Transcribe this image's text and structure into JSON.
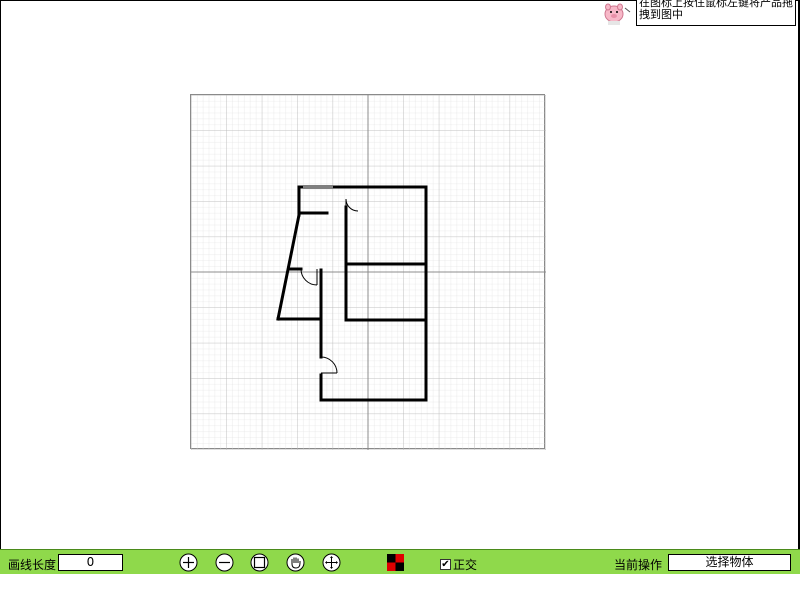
{
  "tip": {
    "text": "在图标上按住鼠标左键将产品拖拽到图中"
  },
  "icons": {
    "pig": "pig-mascot-icon",
    "zoom_in": "zoom-in-icon",
    "zoom_out": "zoom-out-icon",
    "fit": "fit-to-screen-icon",
    "pan": "hand-pan-icon",
    "move": "move-arrows-icon",
    "color": "color-picker-icon"
  },
  "toolbar": {
    "line_length_label": "画线长度",
    "line_length_value": "0",
    "ortho_label": "正交",
    "ortho_checked": true,
    "current_op_label": "当前操作",
    "current_op_value": "选择物体"
  },
  "colors": {
    "toolbar_bg": "#8fd94b",
    "grid_minor": "#d6d6d6",
    "grid_major": "#9a9a9a",
    "wall": "#000000",
    "swatch_red": "#e00000"
  }
}
